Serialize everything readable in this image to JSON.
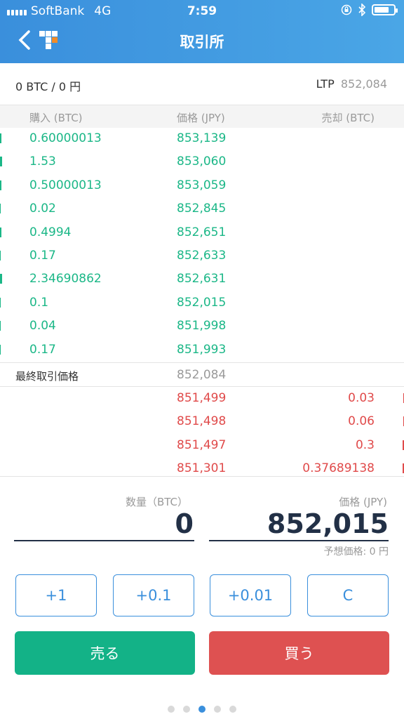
{
  "status_bar": {
    "carrier": "SoftBank",
    "network": "4G",
    "time": "7:59",
    "battery_level": 0.75
  },
  "nav": {
    "title": "取引所",
    "back_icon": "chevron-left-icon",
    "logo_icon": "bitflyer-logo-icon"
  },
  "balance": {
    "text": "0 BTC / 0 円",
    "ltp_label": "LTP",
    "ltp_value": "852,084"
  },
  "book": {
    "headers": {
      "buy": "購入 (BTC)",
      "price": "価格 (JPY)",
      "sell": "売却 (BTC)"
    },
    "bids": [
      {
        "qty": "0.60000013",
        "price": "853,139",
        "depth": 0.6
      },
      {
        "qty": "1.53",
        "price": "853,060",
        "depth": 1.0
      },
      {
        "qty": "0.50000013",
        "price": "853,059",
        "depth": 0.5
      },
      {
        "qty": "0.02",
        "price": "852,845",
        "depth": 0.3
      },
      {
        "qty": "0.4994",
        "price": "852,651",
        "depth": 0.5
      },
      {
        "qty": "0.17",
        "price": "852,633",
        "depth": 0.3
      },
      {
        "qty": "2.34690862",
        "price": "852,631",
        "depth": 1.0
      },
      {
        "qty": "0.1",
        "price": "852,015",
        "depth": 0.3
      },
      {
        "qty": "0.04",
        "price": "851,998",
        "depth": 0.3
      },
      {
        "qty": "0.17",
        "price": "851,993",
        "depth": 0.3
      }
    ],
    "last_trade_label": "最終取引価格",
    "last_trade_price": "852,084",
    "asks": [
      {
        "price": "851,499",
        "qty": "0.03",
        "depth": 0.3
      },
      {
        "price": "851,498",
        "qty": "0.06",
        "depth": 0.3
      },
      {
        "price": "851,497",
        "qty": "0.3",
        "depth": 0.5
      },
      {
        "price": "851,301",
        "qty": "0.37689138",
        "depth": 0.5
      }
    ]
  },
  "order": {
    "qty_label": "数量（BTC）",
    "qty_value": "0",
    "price_label": "価格 (JPY)",
    "price_value": "852,015",
    "estimate": "予想価格: 0 円"
  },
  "quick_buttons": [
    "+1",
    "+0.1",
    "+0.01",
    "C"
  ],
  "actions": {
    "sell": "売る",
    "buy": "買う"
  },
  "pager": {
    "count": 5,
    "active_index": 2
  },
  "colors": {
    "accent": "#3a8fdc",
    "bid": "#1bb787",
    "ask": "#e04a4a",
    "sell_button": "#13b287",
    "buy_button": "#de5151"
  }
}
